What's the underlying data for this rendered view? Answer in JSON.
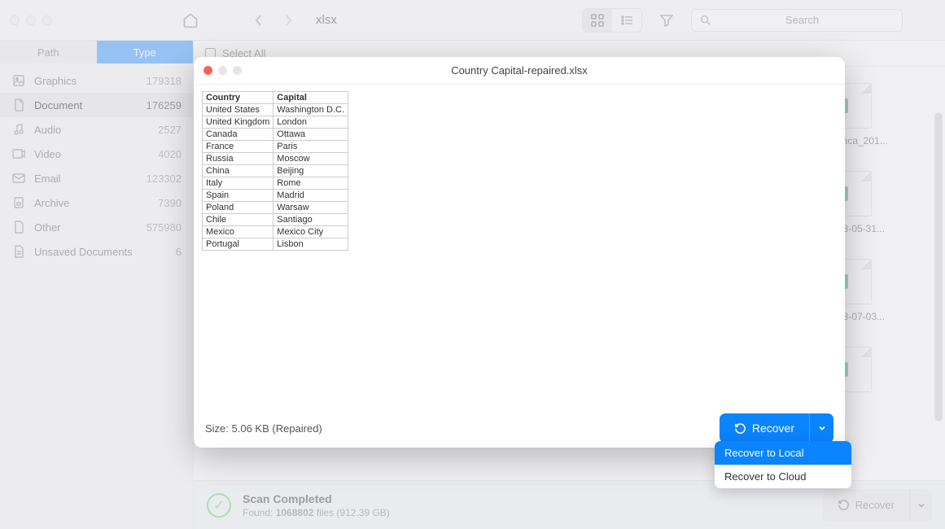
{
  "toolbar": {
    "breadcrumb": "xlsx",
    "search_placeholder": "Search"
  },
  "sidebar": {
    "tabs": {
      "path": "Path",
      "type": "Type"
    },
    "filters": [
      {
        "label": "Graphics",
        "count": "179318"
      },
      {
        "label": "Document",
        "count": "176259"
      },
      {
        "label": "Audio",
        "count": "2527"
      },
      {
        "label": "Video",
        "count": "4020"
      },
      {
        "label": "Email",
        "count": "123302"
      },
      {
        "label": "Archive",
        "count": "7390"
      },
      {
        "label": "Other",
        "count": "575980"
      },
      {
        "label": "Unsaved Documents",
        "count": "6"
      }
    ]
  },
  "main": {
    "select_all": "Select All",
    "files": [
      "a_bianca_201...",
      "_2018-05-31...",
      "_2018-07-03..."
    ]
  },
  "status": {
    "title": "Scan Completed",
    "found_prefix": "Found: ",
    "found_count": "1068802",
    "found_suffix": " files (912.39 GB)",
    "recover_label": "Recover"
  },
  "modal": {
    "title": "Country Capital-repaired.xlsx",
    "size_label": "Size: ",
    "size_value": "5.06 KB (Repaired)",
    "recover_label": "Recover",
    "dropdown": {
      "local": "Recover to Local",
      "cloud": "Recover to Cloud"
    }
  },
  "chart_data": {
    "type": "table",
    "columns": [
      "Country",
      "Capital"
    ],
    "rows": [
      [
        "United States",
        "Washington D.C."
      ],
      [
        "United Kingdom",
        "London"
      ],
      [
        "Canada",
        "Ottawa"
      ],
      [
        "France",
        "Paris"
      ],
      [
        "Russia",
        "Moscow"
      ],
      [
        "China",
        "Beijing"
      ],
      [
        "Italy",
        "Rome"
      ],
      [
        "Spain",
        "Madrid"
      ],
      [
        "Poland",
        "Warsaw"
      ],
      [
        "Chile",
        "Santiago"
      ],
      [
        "Mexico",
        "Mexico City"
      ],
      [
        "Portugal",
        "Lisbon"
      ]
    ]
  }
}
